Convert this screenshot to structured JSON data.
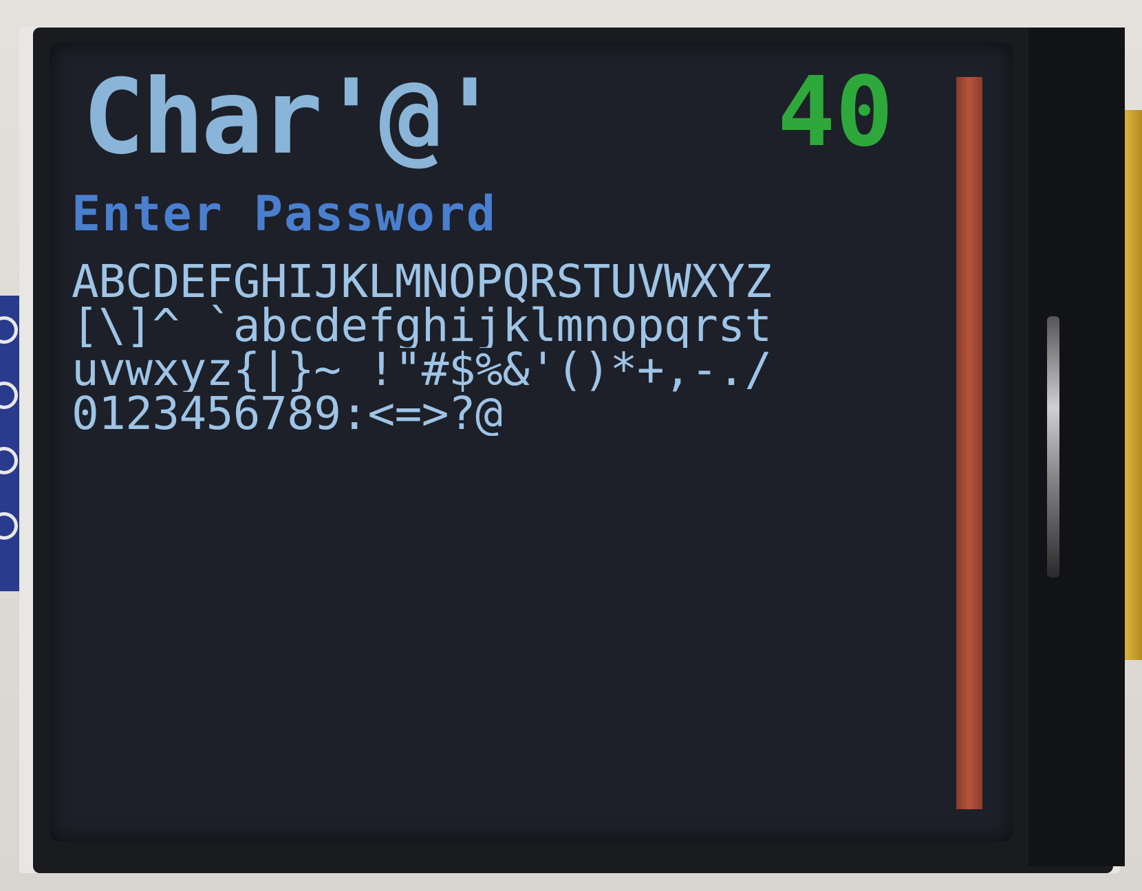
{
  "screen": {
    "title": "Char'@'",
    "count": "40",
    "prompt": "Enter Password",
    "charset_rows": [
      "ABCDEFGHIJKLMNOPQRSTUVWXYZ",
      "[\\]^_`abcdefghijklmnopqrst",
      "uvwxyz{|}~ !\"#$%&'()*+,-./",
      "0123456789:<=>?@"
    ]
  },
  "colors": {
    "title": "#8ab4d8",
    "count": "#2ea83a",
    "prompt": "#4a7fcf",
    "charset": "#9ec4e6",
    "scrollbar": "#b4553b",
    "screen_bg": "#1d2028"
  }
}
